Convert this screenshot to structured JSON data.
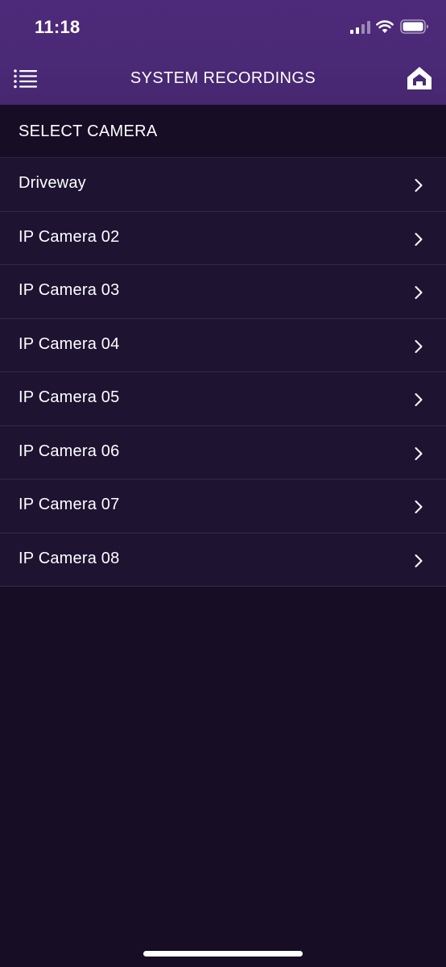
{
  "status_bar": {
    "time": "11:18"
  },
  "nav": {
    "title": "SYSTEM RECORDINGS",
    "menu_icon": "hamburger-menu-icon",
    "home_icon": "home-icon"
  },
  "section": {
    "header": "SELECT CAMERA"
  },
  "cameras": [
    {
      "label": "Driveway"
    },
    {
      "label": "IP Camera 02"
    },
    {
      "label": "IP Camera 03"
    },
    {
      "label": "IP Camera 04"
    },
    {
      "label": "IP Camera 05"
    },
    {
      "label": "IP Camera 06"
    },
    {
      "label": "IP Camera 07"
    },
    {
      "label": "IP Camera 08"
    }
  ],
  "colors": {
    "header_purple": "#4a2976",
    "background": "#170d25",
    "row_background": "#1e1432",
    "text": "#ffffff"
  }
}
